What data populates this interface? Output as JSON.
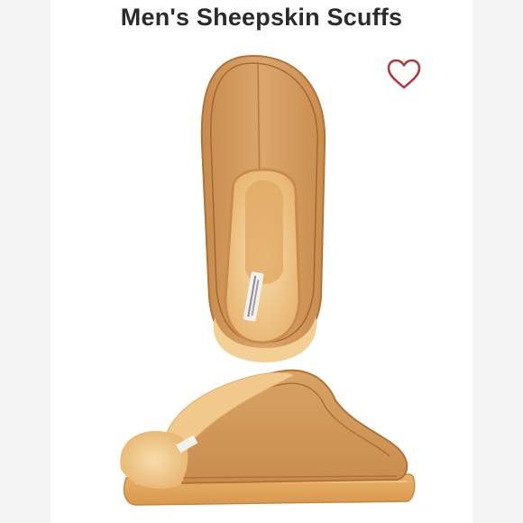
{
  "listing": {
    "title": "Men's Sheepskin Scuffs",
    "favorite_icon": "heart-outline-icon",
    "favorite_color": "#b03a3a"
  },
  "product_image": {
    "subject": "chestnut suede sheepskin scuff slippers (top and side view)",
    "colors": {
      "suede": "#d29a5c",
      "suede_dark": "#b9793d",
      "fleece": "#f0c98e",
      "sole": "#e3a55b"
    }
  }
}
